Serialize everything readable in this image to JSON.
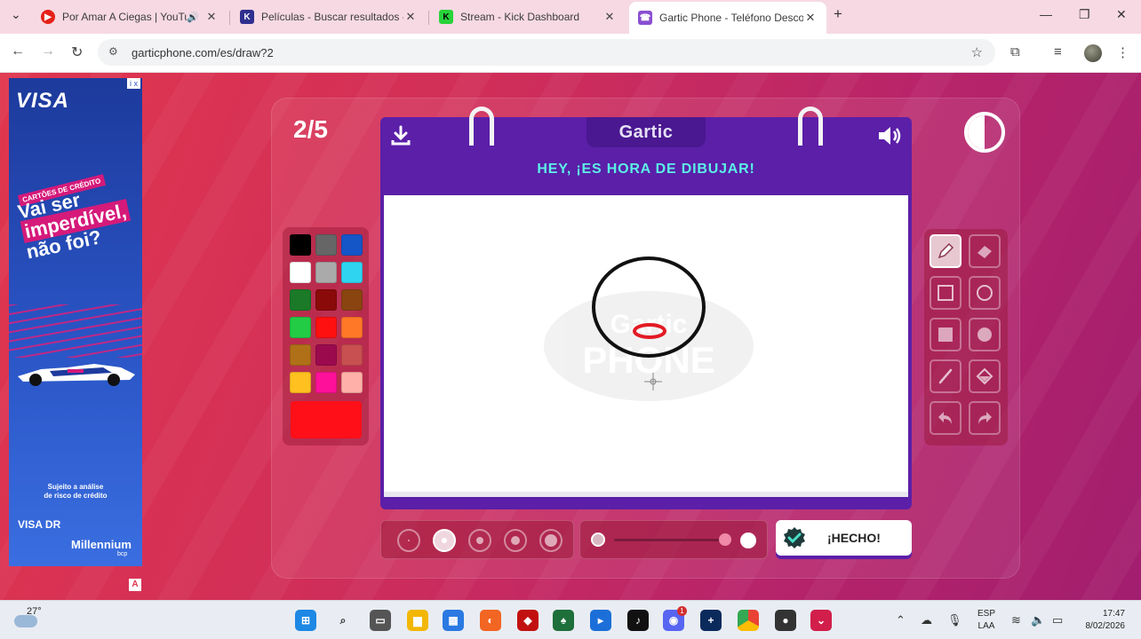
{
  "browser": {
    "tabs": [
      {
        "title": "Por Amar A Ciegas | YouTube",
        "favicon_color": "#e62117",
        "audible": true
      },
      {
        "title": "Películas - Buscar resultados - K",
        "favicon_color": "#2f2f8f",
        "favicon_letter": "K"
      },
      {
        "title": "Stream - Kick Dashboard",
        "favicon_color": "#29d33a",
        "favicon_letter": "K"
      },
      {
        "title": "Gartic Phone - Teléfono Descon",
        "favicon_color": "#8a4fd1",
        "active": true
      }
    ],
    "new_tab_label": "+",
    "url": "garticphone.com/es/draw?2"
  },
  "ad": {
    "brand": "VISA",
    "tag": "CARTÕES DE CRÉDITO",
    "headline_1": "Vai ser",
    "headline_2": "imperdível,",
    "headline_3": "não foi?",
    "fine_print_1": "Sujeito a análise",
    "fine_print_2": "de risco de crédito",
    "sub_brand": "VISA DR",
    "bank": "Millennium",
    "bank_sub": "bcp",
    "adchoice": "i x",
    "corner_badge": "A"
  },
  "game": {
    "round": "2/5",
    "logo": "Gartic",
    "prompt": "HEY, ¡ES HORA DE DIBUJAR!",
    "done_label": "¡HECHO!",
    "current_color": "#ff0f18",
    "palette": [
      "#000000",
      "#666666",
      "#1456c8",
      "#ffffff",
      "#aaaaaa",
      "#2fd4f0",
      "#1a7a28",
      "#8a0a0a",
      "#8a4410",
      "#22cc44",
      "#ff1010",
      "#ff7828",
      "#b07018",
      "#9c0a4e",
      "#c85050",
      "#ffc020",
      "#ff109a",
      "#ffb0a8"
    ],
    "tools": [
      "pencil",
      "eraser",
      "rectangle-outline",
      "ellipse-outline",
      "rectangle-filled",
      "ellipse-filled",
      "line",
      "bucket",
      "undo",
      "redo"
    ],
    "selected_tool": "pencil",
    "brush_sizes_count": 5,
    "selected_brush_size": 2,
    "opacity": 1.0,
    "watermark": "Gartic PHONE"
  },
  "taskbar": {
    "temperature": "27°",
    "language_1": "ESP",
    "language_2": "LAA",
    "time": "17:47",
    "date": "8/02/2026",
    "notification_badge": "1"
  }
}
